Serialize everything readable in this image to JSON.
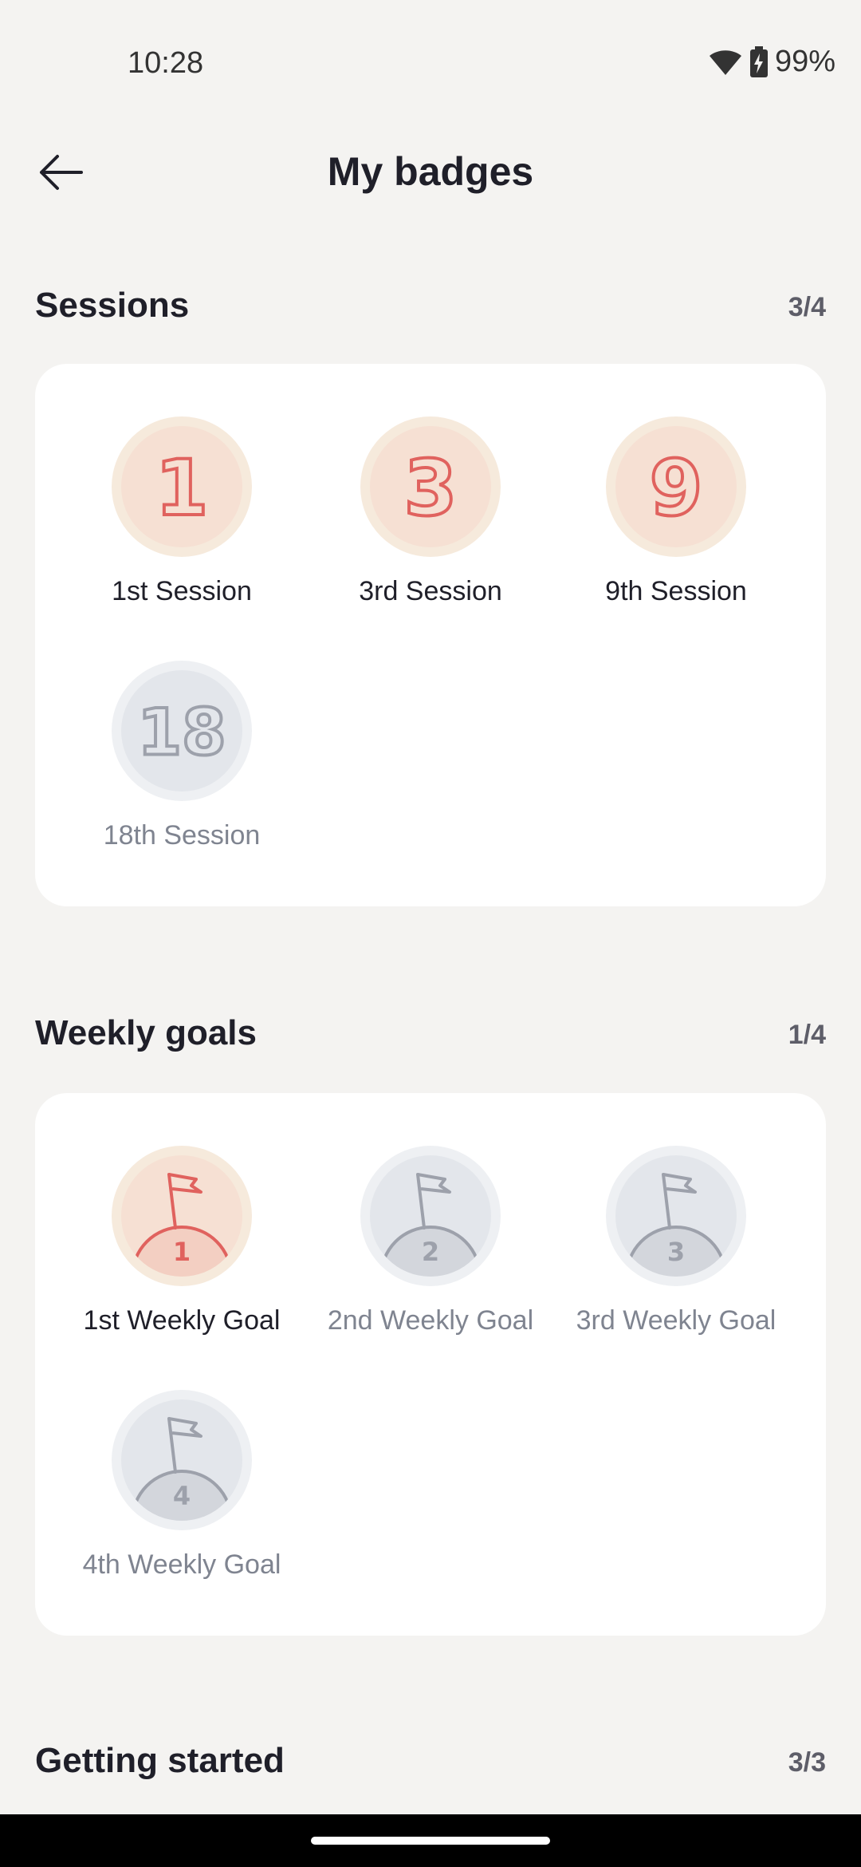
{
  "status_bar": {
    "time": "10:28",
    "battery": "99%"
  },
  "header": {
    "title": "My badges"
  },
  "sessions": {
    "title": "Sessions",
    "count": "3/4",
    "badges": [
      {
        "numeral": "1",
        "label": "1st Session",
        "earned": true
      },
      {
        "numeral": "3",
        "label": "3rd Session",
        "earned": true
      },
      {
        "numeral": "9",
        "label": "9th Session",
        "earned": true
      },
      {
        "numeral": "18",
        "label": "18th Session",
        "earned": false
      }
    ]
  },
  "weekly_goals": {
    "title": "Weekly goals",
    "count": "1/4",
    "badges": [
      {
        "numeral": "1",
        "label": "1st Weekly Goal",
        "earned": true
      },
      {
        "numeral": "2",
        "label": "2nd Weekly Goal",
        "earned": false
      },
      {
        "numeral": "3",
        "label": "3rd Weekly Goal",
        "earned": false
      },
      {
        "numeral": "4",
        "label": "4th Weekly Goal",
        "earned": false
      }
    ]
  },
  "getting_started": {
    "title": "Getting started",
    "count": "3/3"
  },
  "colors": {
    "earned_accent": "#e0625e",
    "locked_accent": "#9da1ab",
    "background": "#f4f3f1",
    "card": "#ffffff"
  }
}
